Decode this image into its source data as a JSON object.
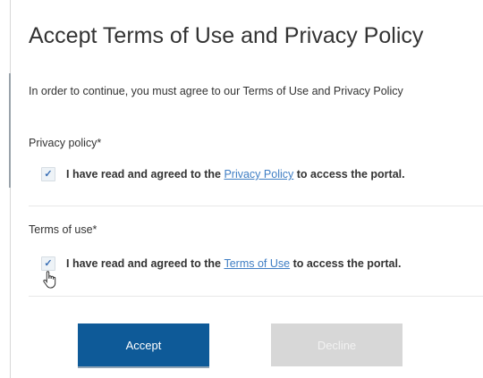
{
  "dialog": {
    "title": "Accept Terms of Use and Privacy Policy",
    "intro": "In order to continue, you must agree to our Terms of Use and Privacy Policy",
    "privacy_section": {
      "label": "Privacy policy*",
      "checked": true,
      "text_before": "I have read and agreed to the ",
      "link_text": "Privacy Policy",
      "text_after": " to access the portal."
    },
    "terms_section": {
      "label": "Terms of use*",
      "checked": true,
      "text_before": "I have read and agreed to the ",
      "link_text": "Terms of Use",
      "text_after": " to access the portal."
    },
    "buttons": {
      "accept_label": "Accept",
      "decline_label": "Decline"
    }
  },
  "icons": {
    "checkbox": "checkmark-icon",
    "cursor": "hand-pointer-icon"
  },
  "colors": {
    "primary_button": "#0e5a98",
    "disabled_button": "#d7d7d7",
    "link": "#3f7ec4",
    "text": "#333333"
  }
}
